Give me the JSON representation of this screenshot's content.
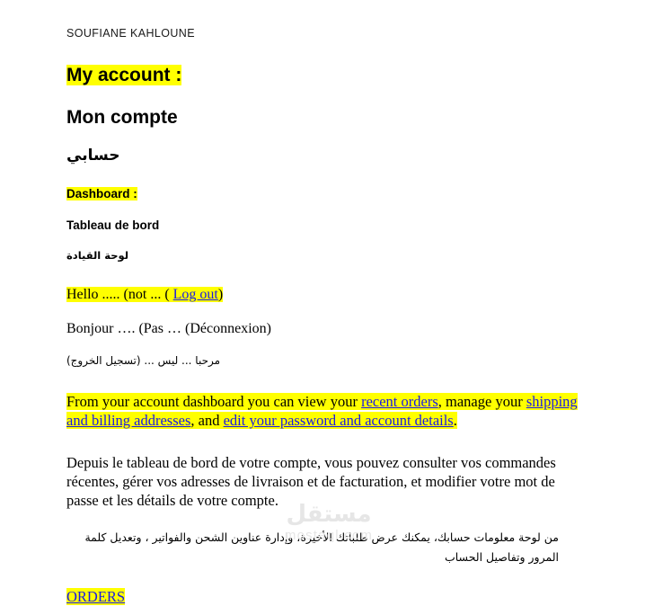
{
  "document": {
    "author": "SOUFIANE KAHLOUNE",
    "colors": {
      "highlight": "#ffff00",
      "link": "#1a1ae6",
      "text": "#000000",
      "background": "#ffffff",
      "watermark": "#e6e6e6"
    }
  },
  "headings": {
    "my_account_en": "My account :",
    "my_account_fr": "Mon compte",
    "my_account_ar": "حسابي",
    "dashboard_en": "Dashboard :",
    "dashboard_fr": "Tableau de bord",
    "dashboard_ar": "لوحة القيادة"
  },
  "greeting": {
    "en_before": "Hello ..... (not ...   (  ",
    "en_link": "Log out",
    "en_after": ")",
    "fr": "Bonjour …. (Pas … (Déconnexion)",
    "ar": "مرحبا ... ليس ... (تسجيل الخروج)"
  },
  "intro": {
    "en": {
      "seg1": "From your account dashboard you can view your ",
      "link1": "recent orders",
      "seg2": ", manage your ",
      "link2": "shipping and billing addresses",
      "seg3": ", and ",
      "link3": "edit your password and account details",
      "seg4": "."
    },
    "fr": "Depuis le tableau de bord de votre compte, vous pouvez consulter vos commandes récentes, gérer vos adresses de livraison et de facturation, et modifier votre mot de passe et les détails de votre compte.",
    "ar": "من لوحة معلومات حسابك، يمكنك عرض طلباتك الأخيرة، وإدارة عناوين الشحن والفواتير ، وتعديل كلمة المرور وتفاصيل الحساب"
  },
  "orders": {
    "label": "ORDERS"
  },
  "watermark": {
    "arabic": "مستقل",
    "latin": "mostaql.com"
  }
}
